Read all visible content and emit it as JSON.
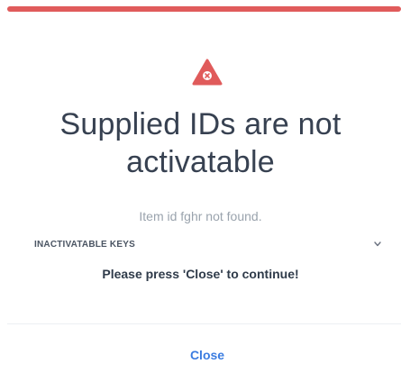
{
  "colors": {
    "accent": "#e05b5b",
    "link": "#3b7ce0"
  },
  "dialog": {
    "status_icon": "alert-triangle-x-icon",
    "title": "Supplied IDs are not activatable",
    "message": "Item id fghr not found.",
    "keys_label": "INACTIVATABLE KEYS",
    "keys_chevron_icon": "chevron-down-icon",
    "instruction": "Please press 'Close' to continue!",
    "close_label": "Close"
  }
}
